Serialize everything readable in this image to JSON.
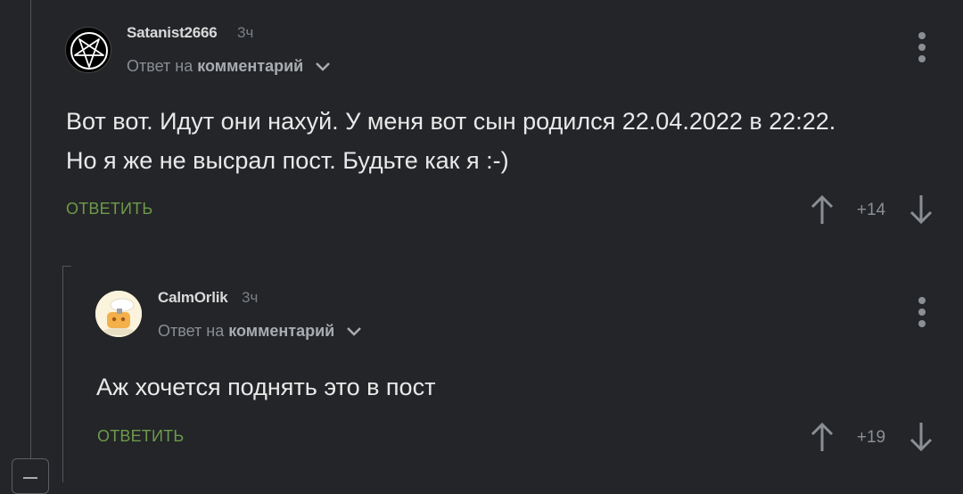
{
  "comments": [
    {
      "author": "Satanist2666",
      "time": "3ч",
      "reply_prefix": "Ответ на",
      "reply_target": "комментарий",
      "lines": [
        "Вот вот. Идут они нахуй. У меня вот сын родился 22.04.2022 в 22:22.",
        "Но я же не высрал пост. Будьте как я :-)"
      ],
      "reply_label": "ОТВЕТИТЬ",
      "rating": "+14",
      "avatar_icon": "pentagram-icon"
    },
    {
      "author": "CalmOrlik",
      "time": "3ч",
      "reply_prefix": "Ответ на",
      "reply_target": "комментарий",
      "lines": [
        "Аж хочется поднять это в пост"
      ],
      "reply_label": "ОТВЕТИТЬ",
      "rating": "+19",
      "avatar_icon": "cartoon-avatar-icon"
    }
  ],
  "colors": {
    "background": "#232528",
    "accent_reply": "#6f9a4b",
    "thread_line": "#52565b"
  }
}
